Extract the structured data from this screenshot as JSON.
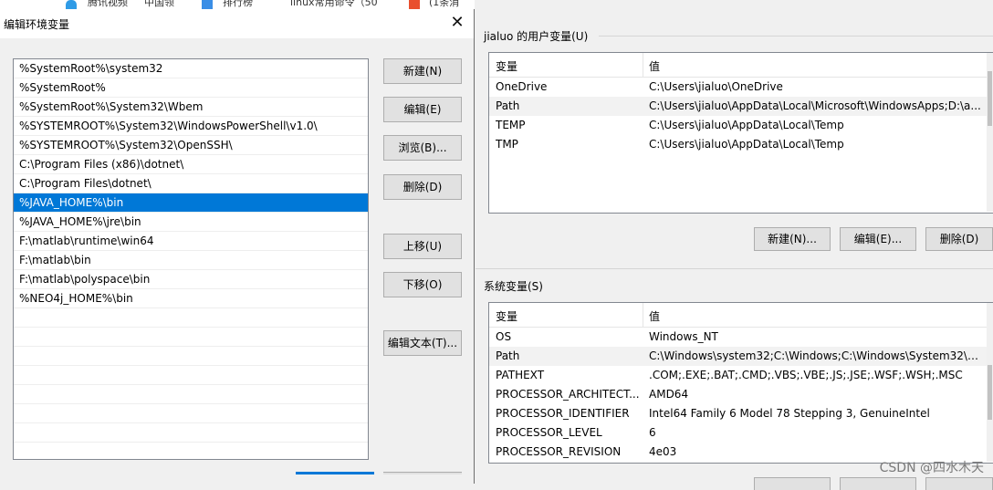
{
  "topbar": {
    "bookmarks": [
      "腾讯视频",
      "中国领",
      "排行榜",
      "linux常用命令（50",
      "(1条消"
    ]
  },
  "dialog": {
    "title": "编辑环境变量",
    "close_glyph": "✕",
    "paths": [
      "%SystemRoot%\\system32",
      "%SystemRoot%",
      "%SystemRoot%\\System32\\Wbem",
      "%SYSTEMROOT%\\System32\\WindowsPowerShell\\v1.0\\",
      "%SYSTEMROOT%\\System32\\OpenSSH\\",
      "C:\\Program Files (x86)\\dotnet\\",
      "C:\\Program Files\\dotnet\\",
      "%JAVA_HOME%\\bin",
      "%JAVA_HOME%\\jre\\bin",
      "F:\\matlab\\runtime\\win64",
      "F:\\matlab\\bin",
      "F:\\matlab\\polyspace\\bin",
      "%NEO4j_HOME%\\bin"
    ],
    "selected_index": 7,
    "buttons": {
      "new": "新建(N)",
      "edit": "编辑(E)",
      "browse": "浏览(B)...",
      "delete": "删除(D)",
      "move_up": "上移(U)",
      "move_down": "下移(O)",
      "edit_text": "编辑文本(T)..."
    }
  },
  "env": {
    "user_group_label": "jialuo 的用户变量(U)",
    "system_group_label": "系统变量(S)",
    "col_var": "变量",
    "col_val": "值",
    "user_vars": [
      {
        "name": "OneDrive",
        "value": "C:\\Users\\jialuo\\OneDrive"
      },
      {
        "name": "Path",
        "value": "C:\\Users\\jialuo\\AppData\\Local\\Microsoft\\WindowsApps;D:\\a..."
      },
      {
        "name": "TEMP",
        "value": "C:\\Users\\jialuo\\AppData\\Local\\Temp"
      },
      {
        "name": "TMP",
        "value": "C:\\Users\\jialuo\\AppData\\Local\\Temp"
      }
    ],
    "user_buttons": {
      "new": "新建(N)...",
      "edit": "编辑(E)...",
      "delete": "删除(D)"
    },
    "system_vars": [
      {
        "name": "OS",
        "value": "Windows_NT"
      },
      {
        "name": "Path",
        "value": "C:\\Windows\\system32;C:\\Windows;C:\\Windows\\System32\\Wb..."
      },
      {
        "name": "PATHEXT",
        "value": ".COM;.EXE;.BAT;.CMD;.VBS;.VBE;.JS;.JSE;.WSF;.WSH;.MSC"
      },
      {
        "name": "PROCESSOR_ARCHITECT...",
        "value": "AMD64"
      },
      {
        "name": "PROCESSOR_IDENTIFIER",
        "value": "Intel64 Family 6 Model 78 Stepping 3, GenuineIntel"
      },
      {
        "name": "PROCESSOR_LEVEL",
        "value": "6"
      },
      {
        "name": "PROCESSOR_REVISION",
        "value": "4e03"
      }
    ]
  },
  "watermark": "CSDN @四水木天",
  "colors": {
    "selection": "#0078d7",
    "button_face": "#e1e1e1",
    "button_border": "#adadad"
  }
}
